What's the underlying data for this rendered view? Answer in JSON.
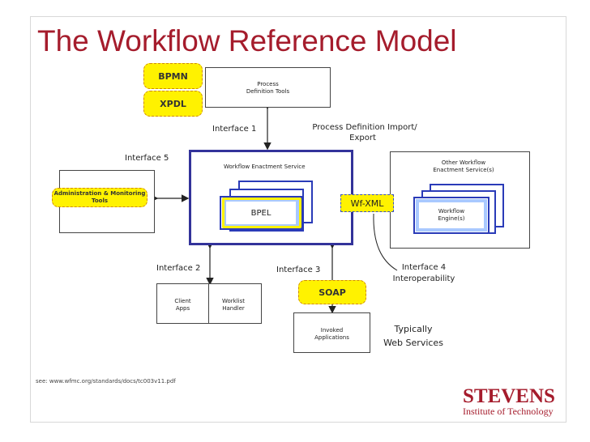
{
  "slide": {
    "title": "The Workflow Reference Model",
    "footer": "see: www.wfmc.org/standards/docs/tc003v11.pdf"
  },
  "highlights": {
    "bpmn": "BPMN",
    "xpdl": "XPDL",
    "soap": "SOAP",
    "wfxml": "Wf-XML",
    "bpel": "BPEL"
  },
  "boxes": {
    "process_definition_tools": [
      "Process",
      "Definition Tools"
    ],
    "workflow_enactment_service": "Workflow Enactment Service",
    "other_enactment_service": [
      "Other Workflow",
      "Enactment Service(s)"
    ],
    "workflow_engines": [
      "Workflow",
      "Engine(s)"
    ],
    "admin_tools": [
      "Administration & Monitoring",
      "Tools"
    ],
    "client_apps": [
      "Client",
      "Apps"
    ],
    "worklist_handler": [
      "Worklist",
      "Handler"
    ],
    "invoked_applications": [
      "Invoked",
      "Applications"
    ]
  },
  "labels": {
    "interface1": "Interface 1",
    "interface2": "Interface 2",
    "interface3": "Interface 3",
    "interface4": [
      "Interface 4",
      "Interoperability"
    ],
    "interface5": "Interface 5",
    "process_definition_import": [
      "Process Definition Import/",
      "Export"
    ],
    "typically": [
      "Typically",
      "Web Services"
    ]
  },
  "logo": {
    "name": "STEVENS",
    "subtitle": "Institute of Technology"
  },
  "colors": {
    "title": "#a51c2c",
    "highlight": "#fff200",
    "engine_border": "#33339a",
    "card_border": "#2a3bb8"
  }
}
